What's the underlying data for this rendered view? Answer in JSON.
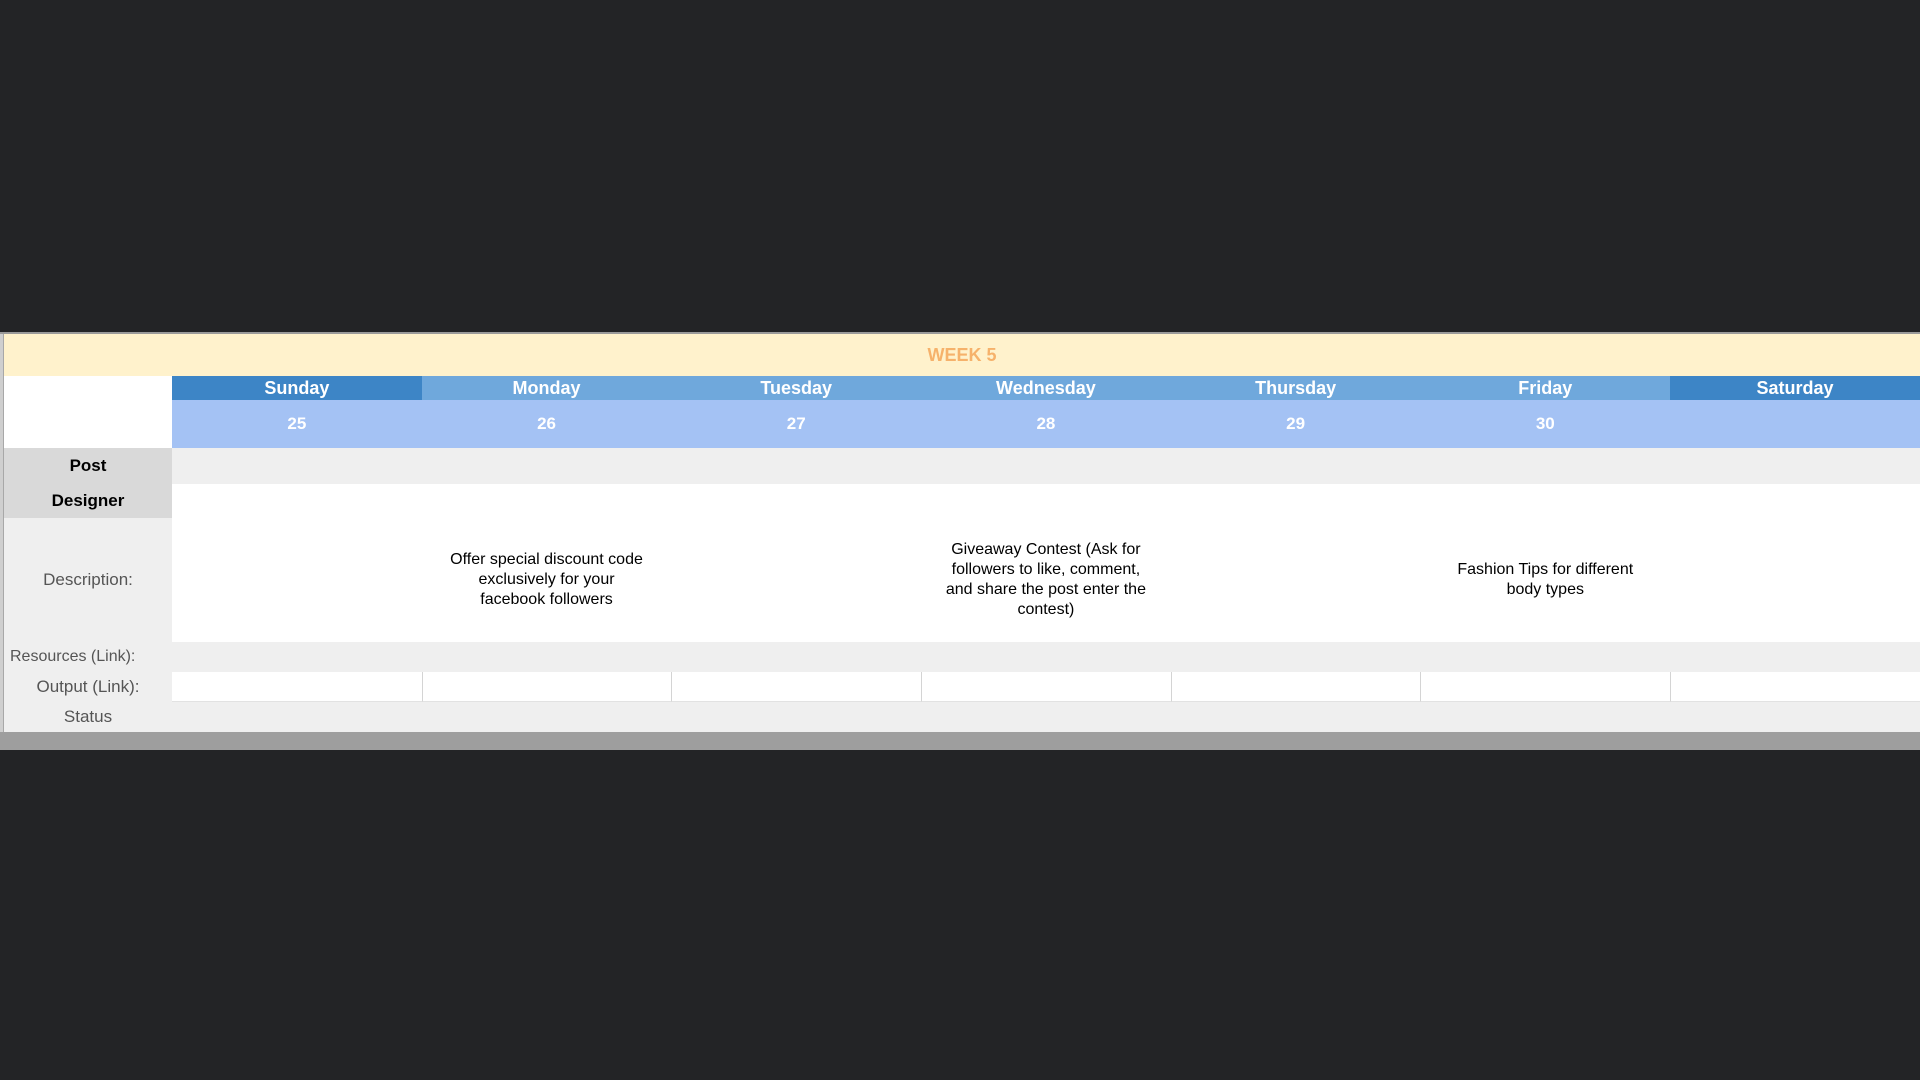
{
  "week": {
    "title": "WEEK 5"
  },
  "days": [
    {
      "name": "Sunday",
      "date": "25",
      "description": ""
    },
    {
      "name": "Monday",
      "date": "26",
      "description": "Offer special discount code exclusively for your facebook followers"
    },
    {
      "name": "Tuesday",
      "date": "27",
      "description": ""
    },
    {
      "name": "Wednesday",
      "date": "28",
      "description": "Giveaway Contest (Ask for followers to like, comment, and share the post enter the contest)"
    },
    {
      "name": "Thursday",
      "date": "29",
      "description": ""
    },
    {
      "name": "Friday",
      "date": "30",
      "description": "Fashion Tips for different body types"
    },
    {
      "name": "Saturday",
      "date": "",
      "description": ""
    }
  ],
  "row_labels": {
    "post": "Post",
    "designer": "Designer",
    "description": "Description:",
    "resources": "Resources (Link):",
    "output": "Output (Link):",
    "status": "Status"
  },
  "colors": {
    "background": "#232426",
    "week_bg": "#fff2cc",
    "week_text": "#f6b26b",
    "day_header_dark": "#3d85c6",
    "day_header_light": "#6fa8dc",
    "date_row": "#a4c2f4",
    "label_bg": "#d9d9d9"
  }
}
